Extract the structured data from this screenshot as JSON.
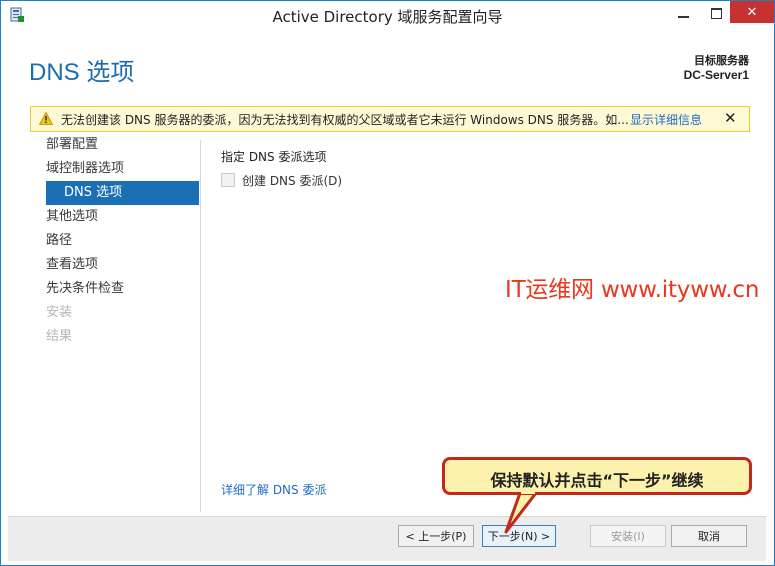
{
  "window": {
    "title": "Active Directory 域服务配置向导",
    "app_icon": "server-manager-icon",
    "controls": {
      "minimize_icon": "minimize-icon",
      "maximize_icon": "maximize-icon",
      "close_icon": "close-icon",
      "close_glyph": "✕"
    }
  },
  "header": {
    "page_title": "DNS 选项",
    "target_label": "目标服务器",
    "target_name": "DC-Server1"
  },
  "warning": {
    "icon": "warning-icon",
    "text": "无法创建该 DNS 服务器的委派，因为无法找到有权威的父区域或者它未运行 Windows DNS 服务器。如...",
    "link": "显示详细信息",
    "close_glyph": "✕"
  },
  "nav": {
    "items": [
      {
        "label": "部署配置",
        "state": "normal"
      },
      {
        "label": "域控制器选项",
        "state": "normal"
      },
      {
        "label": "DNS 选项",
        "state": "active"
      },
      {
        "label": "其他选项",
        "state": "normal"
      },
      {
        "label": "路径",
        "state": "normal"
      },
      {
        "label": "查看选项",
        "state": "normal"
      },
      {
        "label": "先决条件检查",
        "state": "normal"
      },
      {
        "label": "安装",
        "state": "disabled"
      },
      {
        "label": "结果",
        "state": "disabled"
      }
    ]
  },
  "content": {
    "section_label": "指定 DNS 委派选项",
    "checkbox_label": "创建 DNS 委派(D)",
    "checkbox_checked": false,
    "help_link": "详细了解 DNS 委派"
  },
  "watermark": "IT运维网 www.ityww.cn",
  "callout": "保持默认并点击“下一步”继续",
  "buttons": {
    "prev": "< 上一步(P)",
    "next": "下一步(N) >",
    "install": "安装(I)",
    "cancel": "取消"
  },
  "colors": {
    "accent": "#1b6fb5",
    "title_blue": "#1d6bb0",
    "warning_bg": "#fdf9d4",
    "close_red": "#c7312f",
    "watermark_red": "#e8381f",
    "callout_bg": "#fcf1ad",
    "callout_border": "#c2281c"
  }
}
